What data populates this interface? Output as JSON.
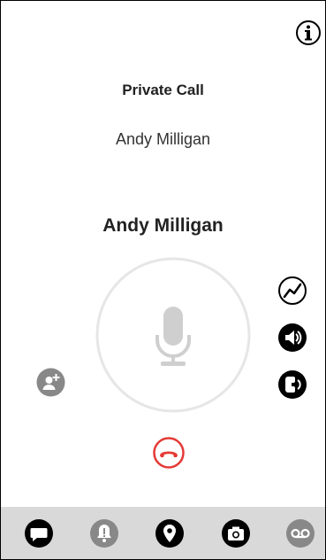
{
  "call": {
    "type_label": "Private Call",
    "callee_secondary": "Andy Milligan",
    "callee_primary": "Andy Milligan"
  },
  "colors": {
    "end_call": "#e53935",
    "ring": "#e6e6e6",
    "mic_disabled": "#cfcfcf",
    "icon_dark": "#000000",
    "icon_muted": "#888888",
    "bottom_bar": "#d9d9d9"
  },
  "icons": {
    "info": "info-icon",
    "ptt": "microphone-icon",
    "add_participant": "add-person-icon",
    "signal": "signal-quality-icon",
    "speaker": "speaker-icon",
    "earpiece": "handset-icon",
    "end_call": "end-call-icon"
  },
  "tabs": [
    {
      "icon": "chat-bubble-icon",
      "state": "active"
    },
    {
      "icon": "alert-bell-icon",
      "state": "muted"
    },
    {
      "icon": "location-pin-icon",
      "state": "active"
    },
    {
      "icon": "camera-icon",
      "state": "active"
    },
    {
      "icon": "voicemail-icon",
      "state": "muted"
    }
  ]
}
